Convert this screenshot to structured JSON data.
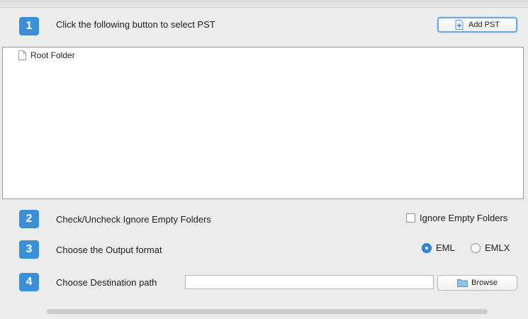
{
  "steps": [
    {
      "number": "1",
      "label": "Click the following button to select PST"
    },
    {
      "number": "2",
      "label": "Check/Uncheck Ignore Empty Folders"
    },
    {
      "number": "3",
      "label": "Choose the Output format"
    },
    {
      "number": "4",
      "label": "Choose Destination path"
    }
  ],
  "add_pst": {
    "label": "Add PST",
    "icon": "add-file-icon"
  },
  "tree": {
    "root_label": "Root Folder",
    "icon": "file-icon"
  },
  "ignore_empty": {
    "label": "Ignore Empty Folders",
    "checked": false
  },
  "output_format": {
    "options": [
      {
        "label": "EML",
        "selected": true
      },
      {
        "label": "EMLX",
        "selected": false
      }
    ]
  },
  "destination": {
    "value": "",
    "placeholder": ""
  },
  "browse": {
    "label": "Browse",
    "icon": "folder-icon"
  },
  "colors": {
    "accent": "#3a8fd6",
    "radio_selected": "#2f86dd",
    "background": "#ececec"
  }
}
